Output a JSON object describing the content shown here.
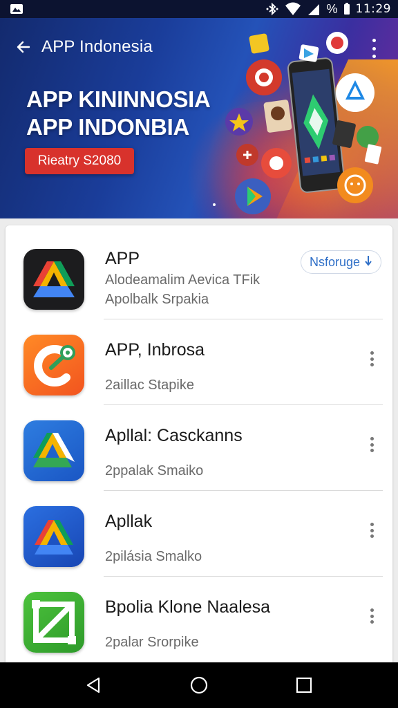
{
  "status_bar": {
    "time": "11:29",
    "battery_text": "%",
    "icons": [
      "notification-icon",
      "bluetooth-icon",
      "wifi-icon",
      "signal-icon",
      "battery-icon"
    ]
  },
  "app_bar": {
    "title": "APP Indonesia",
    "back_icon": "back-arrow-icon",
    "menu_icon": "overflow-menu-icon"
  },
  "banner": {
    "headline_line1": "APP KININNOSIA",
    "headline_line2": "APP INDONBIA",
    "button_label": "Rieatry S2080",
    "colors": {
      "background": "#1a3d9a",
      "button": "#d8322c",
      "accent": "#ff8a1e"
    }
  },
  "list": {
    "items": [
      {
        "title": "APP",
        "subtitle_line1": "Alodeamalim Aevica TFik",
        "subtitle_line2": "Apolbalk Srpakia",
        "action_label": "Nsforuge",
        "action_icon": "download-arrow-icon",
        "icon": "triangle-drive-icon-dark"
      },
      {
        "title": "APP, Inbrosa",
        "subtitle_line1": "2aillac Stapike",
        "icon": "orange-c-icon"
      },
      {
        "title": "Apllal: Casckanns",
        "subtitle_line1": "2ppalak Smaiko",
        "icon": "triangle-drive-icon-blue"
      },
      {
        "title": "Apllak",
        "subtitle_line1": "2pilásia Smalkо",
        "icon": "triangle-drive-icon-blue-2"
      },
      {
        "title": "Bpolia Klone Naalesa",
        "subtitle_line1": "2palar Srorpike",
        "icon": "green-frame-icon"
      }
    ]
  },
  "nav_bar": {
    "icons": [
      "back-nav-icon",
      "home-nav-icon",
      "recents-nav-icon"
    ]
  }
}
